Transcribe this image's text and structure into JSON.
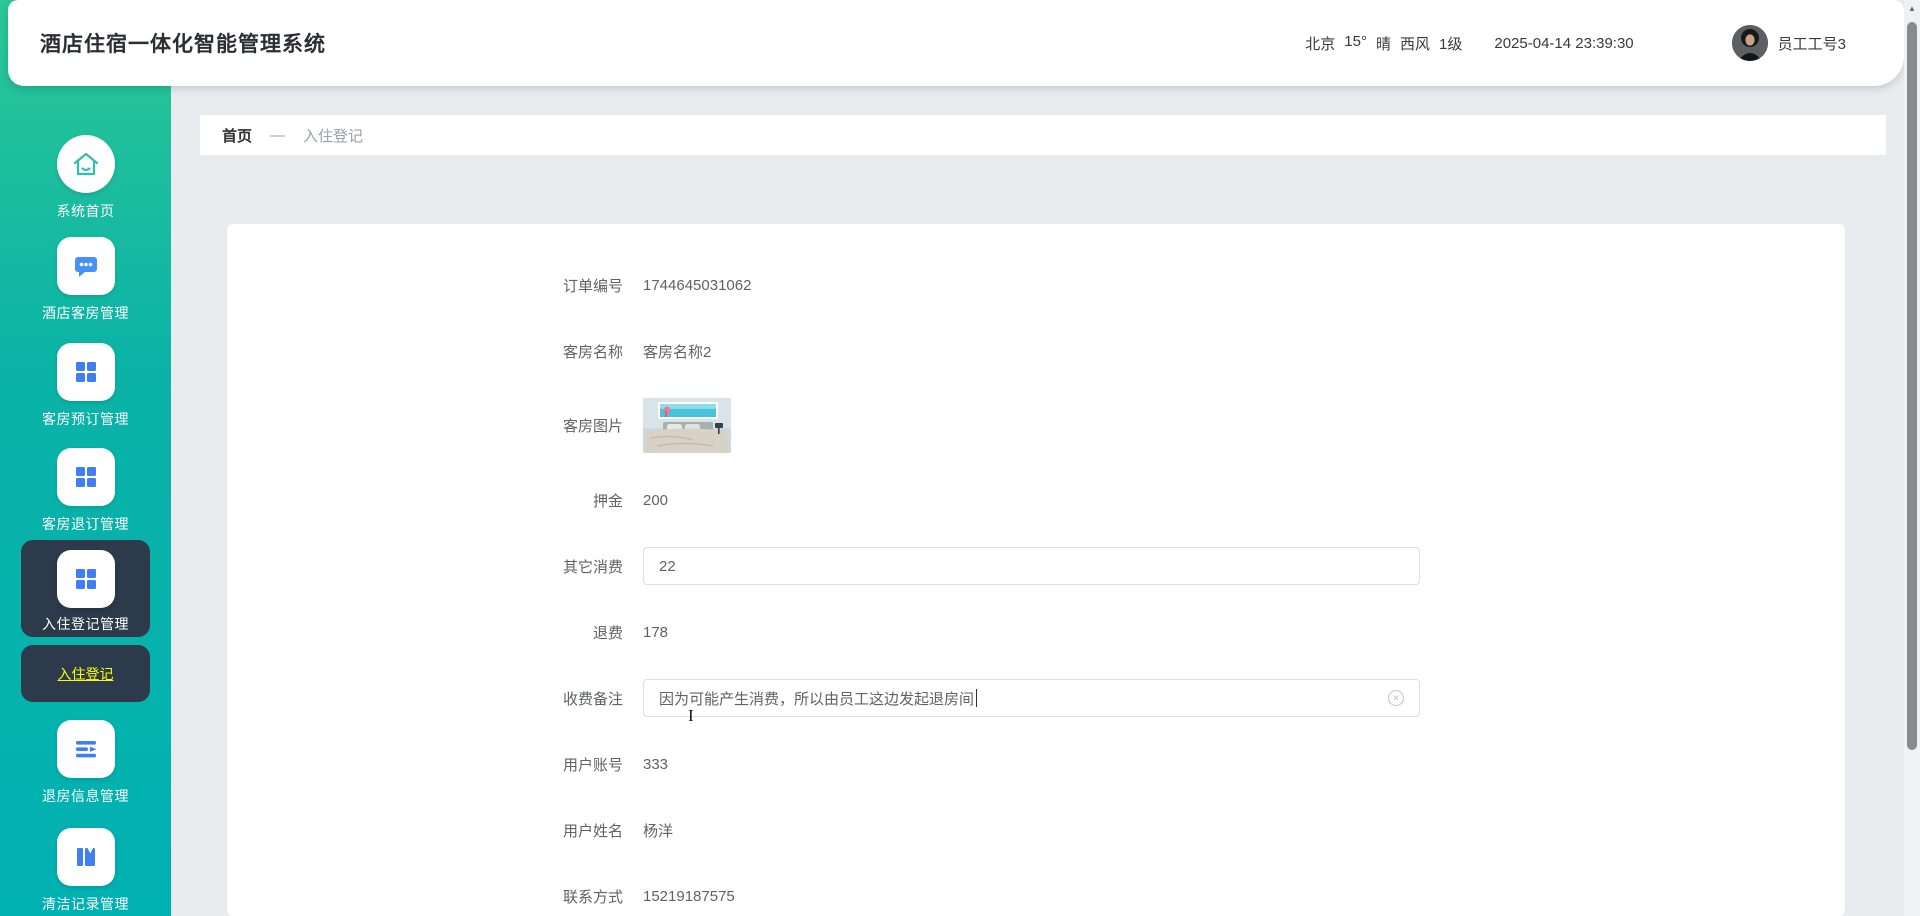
{
  "header": {
    "title": "酒店住宿一体化智能管理系统",
    "weather": {
      "city": "北京",
      "temp": "15°",
      "condition": "晴",
      "wind": "西风",
      "wind_level": "1级"
    },
    "datetime": "2025-04-14 23:39:30",
    "username": "员工工号3"
  },
  "sidebar": {
    "items": [
      {
        "label": "系统首页",
        "icon": "home-icon"
      },
      {
        "label": "酒店客房管理",
        "icon": "chat-icon"
      },
      {
        "label": "客房预订管理",
        "icon": "grid-icon"
      },
      {
        "label": "客房退订管理",
        "icon": "grid-icon"
      },
      {
        "label": "入住登记管理",
        "icon": "grid-icon",
        "active": true
      },
      {
        "label": "退房信息管理",
        "icon": "list-icon"
      },
      {
        "label": "清洁记录管理",
        "icon": "book-icon"
      }
    ],
    "submenu": {
      "label": "入住登记",
      "active": true
    }
  },
  "breadcrumb": {
    "home": "首页",
    "separator": "—",
    "current": "入住登记"
  },
  "form": {
    "fields": [
      {
        "label": "订单编号",
        "value": "1744645031062",
        "type": "static"
      },
      {
        "label": "客房名称",
        "value": "客房名称2",
        "type": "static"
      },
      {
        "label": "客房图片",
        "value": "",
        "type": "image"
      },
      {
        "label": "押金",
        "value": "200",
        "type": "static"
      },
      {
        "label": "其它消费",
        "value": "22",
        "type": "input"
      },
      {
        "label": "退费",
        "value": "178",
        "type": "static"
      },
      {
        "label": "收费备注",
        "value": "因为可能产生消费，所以由员工这边发起退房间",
        "type": "input-clearable"
      },
      {
        "label": "用户账号",
        "value": "333",
        "type": "static"
      },
      {
        "label": "用户姓名",
        "value": "杨洋",
        "type": "static"
      },
      {
        "label": "联系方式",
        "value": "15219187575",
        "type": "static"
      }
    ]
  },
  "colors": {
    "sidebar_teal": "#00b1b2",
    "sidebar_green": "#2bc795",
    "active_dark": "#2d3a4b",
    "icon_blue": "#4691f6",
    "submenu_yellow": "#fdfd00",
    "home_icon_teal": "#2fbfae"
  }
}
